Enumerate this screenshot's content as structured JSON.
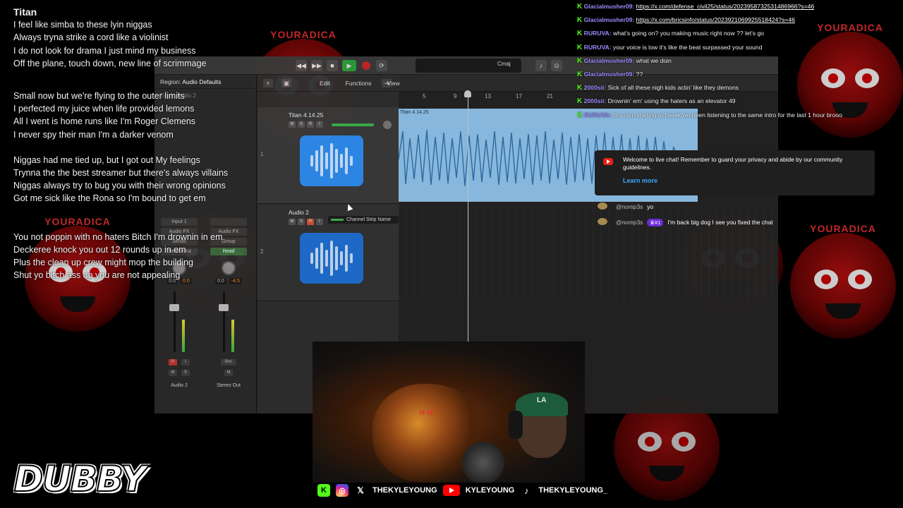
{
  "background": {
    "brand_text": "YOURADICA",
    "accent_color": "#c01010"
  },
  "lyrics": {
    "title": "Titan",
    "stanzas": [
      [
        "I feel like simba to these lyin niggas",
        "Always tryna strike a cord like a violinist",
        "I do not look for drama I just mind my business",
        "Off the plane, touch down, new line of scrimmage"
      ],
      [
        "Small now but we're flying to the outer limits",
        "I perfected my juice when life provided lemons",
        "All I went is home runs like I'm Roger Clemens",
        "I never spy  their man I'm a darker venom"
      ],
      [
        "Niggas had me tied up, but I got out My feelings",
        "Trynna the the best streamer  but there's always villains",
        "Niggas always try to bug you with their wrong opinions",
        "Got me sick like the Rona so I'm bound to get em"
      ],
      [
        "You not poppin with no haters Bitch I'm drownin in em",
        "Deckeree knock you out 12 rounds up in em",
        "Plus the clean up crew might mop the building",
        "Shut yo bitch ass up you are not appealing"
      ]
    ]
  },
  "daw": {
    "key": "Cmaj",
    "inspector": {
      "region_label": "Region:",
      "region_value": "Audio Defaults",
      "track_label": "Track:",
      "track_value": "Audio 2"
    },
    "menu": [
      "Edit",
      "Functions",
      "View"
    ],
    "ruler_ticks": [
      "5",
      "9",
      "13",
      "17",
      "21"
    ],
    "tracks": [
      {
        "number": "1",
        "name": "Titan 4.14.25"
      },
      {
        "number": "2",
        "name": "Audio 2",
        "strip_name": "Channel Strip Name"
      }
    ],
    "region_name": "Titan 4.14.25",
    "strips": [
      {
        "input": "Input 1",
        "fx": "Audio FX",
        "send": "Sends",
        "out": "Stereo Out",
        "v1": "0.0",
        "v2": "0.0",
        "name": "Audio 2"
      },
      {
        "input": "",
        "fx": "Audio FX",
        "send": "Group",
        "out": "Read",
        "v1": "0.0",
        "v2": "-4.5",
        "name": "Stereo Out",
        "bnc": "Bnc"
      }
    ]
  },
  "chat": [
    {
      "user": "Glacialmusher09:",
      "text": "https://x.com/defense_civil25/status/2023958732531486966?s=46",
      "link": true
    },
    {
      "user": "Glacialmusher09:",
      "text": "https://x.com/bricsinfo/status/2023921069925518424?s=46",
      "link": true
    },
    {
      "user": "RURUVA:",
      "text": "what's going on? you making music right now ?? let's go"
    },
    {
      "user": "RURUVA:",
      "text": "your voice is low it's like the beat surpassed your sound"
    },
    {
      "user": "Glacialmusher09:",
      "text": "what we doin"
    },
    {
      "user": "Glacialmusher09:",
      "text": "??"
    },
    {
      "user": "2000sii:",
      "text": "Sick of all these nigh kids actin' like they demons"
    },
    {
      "user": "2000sii:",
      "text": "Drownin' em' using the haters as an elevator 49"
    },
    {
      "user": "RURUVA:",
      "text": "bro i am starting to tweak we been listening to the same intro for the last 1 hour brooo"
    }
  ],
  "notice": {
    "text": "Welcome to live chat! Remember to guard your privacy and abide by our community guidelines.",
    "link": "Learn more"
  },
  "yt_chat": [
    {
      "author": "@nomp3s",
      "text": "yo"
    },
    {
      "author": "@nomp3s",
      "badge": "#1",
      "text": "I'm back big dog I see you fixed the chat"
    }
  ],
  "socials": {
    "kick_glyph": "K",
    "x_glyph": "𝕏",
    "tiktok_glyph": "♪",
    "x_handle": "THEKYLEYOUNG",
    "youtube_handle": "KYLEYOUNG",
    "tiktok_handle": "THEKYLEYOUNG_"
  },
  "webcam": {
    "cap_logo": "LA",
    "foil_text": "N W"
  },
  "logo": "DUBBY"
}
